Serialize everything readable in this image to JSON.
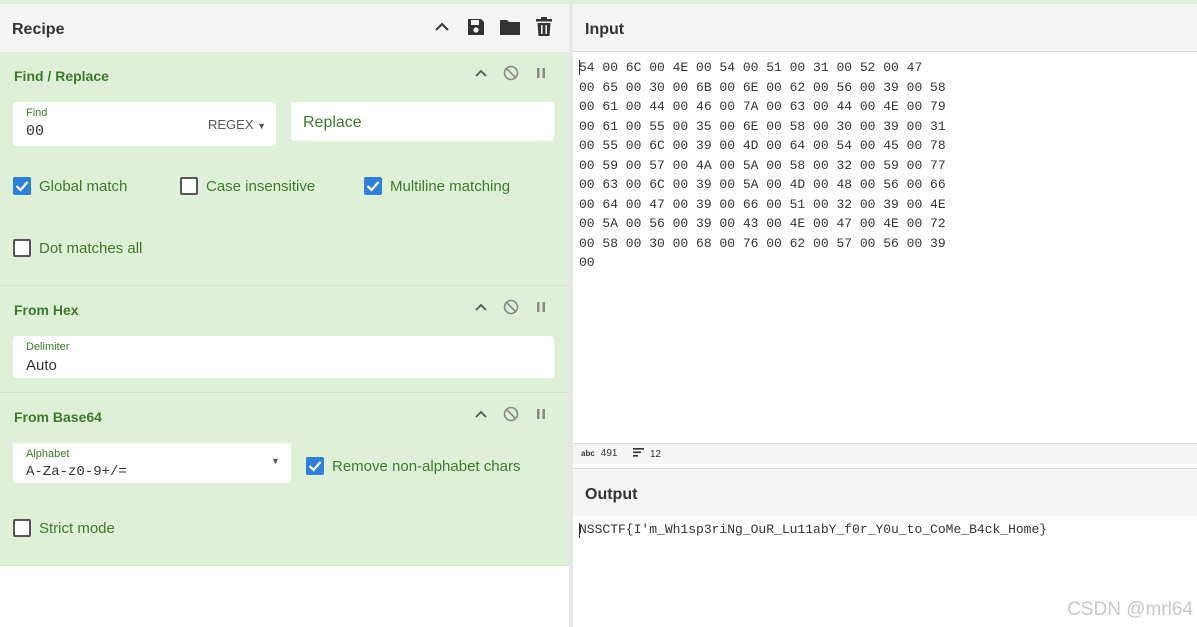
{
  "recipe": {
    "title": "Recipe",
    "header_icons": [
      "chevron-up-icon",
      "save-icon",
      "folder-icon",
      "trash-icon"
    ]
  },
  "operations": {
    "find_replace": {
      "title": "Find / Replace",
      "find_label": "Find",
      "find_value": "00",
      "find_mode": "REGEX",
      "replace_placeholder": "Replace",
      "global_match": "Global match",
      "case_insensitive": "Case insensitive",
      "multiline": "Multiline matching",
      "dot_matches_all": "Dot matches all"
    },
    "from_hex": {
      "title": "From Hex",
      "delimiter_label": "Delimiter",
      "delimiter_value": "Auto"
    },
    "from_base64": {
      "title": "From Base64",
      "alphabet_label": "Alphabet",
      "alphabet_value": "A-Za-z0-9+/=",
      "remove_non_alpha": "Remove non-alphabet chars",
      "strict_mode": "Strict mode"
    }
  },
  "checkbox_state": {
    "global_match": true,
    "case_insensitive": false,
    "multiline": true,
    "dot_matches_all": false,
    "remove_non_alpha": true,
    "strict_mode": false
  },
  "input": {
    "title": "Input",
    "text": "54 00 6C 00 4E 00 54 00 51 00 31 00 52 00 47\n00 65 00 30 00 6B 00 6E 00 62 00 56 00 39 00 58\n00 61 00 44 00 46 00 7A 00 63 00 44 00 4E 00 79\n00 61 00 55 00 35 00 6E 00 58 00 30 00 39 00 31\n00 55 00 6C 00 39 00 4D 00 64 00 54 00 45 00 78\n00 59 00 57 00 4A 00 5A 00 58 00 32 00 59 00 77\n00 63 00 6C 00 39 00 5A 00 4D 00 48 00 56 00 66\n00 64 00 47 00 39 00 66 00 51 00 32 00 39 00 4E\n00 5A 00 56 00 39 00 43 00 4E 00 47 00 4E 00 72\n00 58 00 30 00 68 00 76 00 62 00 57 00 56 00 39\n00",
    "char_count": "491",
    "line_count": "12"
  },
  "output": {
    "title": "Output",
    "text": "NSSCTF{I'm_Wh1sp3riNg_OuR_Lu11abY_f0r_Y0u_to_CoMe_B4ck_Home}"
  },
  "watermark": "CSDN @mrl64",
  "colors": {
    "op_bg": "#dff0d8",
    "op_text": "#3c7a2a",
    "checkbox_on": "#2f7fd8"
  }
}
